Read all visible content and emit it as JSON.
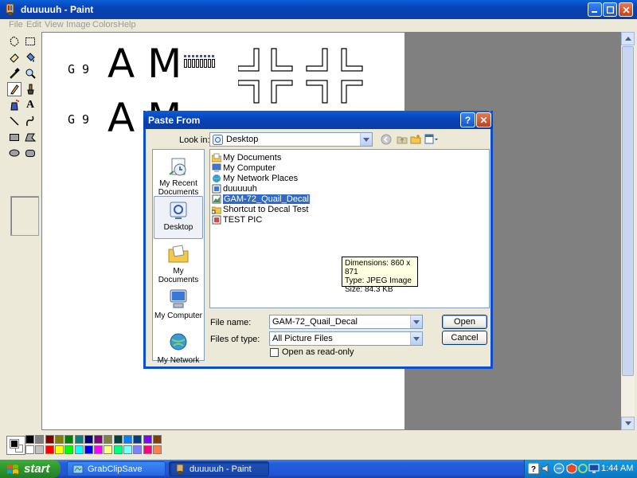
{
  "window": {
    "title": "duuuuuh - Paint"
  },
  "menu": [
    "File",
    "Edit",
    "View",
    "Image",
    "Colors",
    "Help"
  ],
  "canvas_text": {
    "row1_small": "G 9",
    "row1_big": "A M",
    "row2_small": "G 9",
    "row2_big": "A M"
  },
  "dialog": {
    "title": "Paste From",
    "help_glyph": "?",
    "close_glyph": "✕",
    "look_in_label": "Look in:",
    "look_in_value": "Desktop",
    "places": [
      {
        "label": "My Recent Documents",
        "icon": "recent-documents-icon"
      },
      {
        "label": "Desktop",
        "icon": "desktop-icon"
      },
      {
        "label": "My Documents",
        "icon": "my-documents-icon"
      },
      {
        "label": "My Computer",
        "icon": "my-computer-icon"
      },
      {
        "label": "My Network",
        "icon": "my-network-icon"
      }
    ],
    "files": [
      {
        "name": "My Documents",
        "icon": "folder-icon"
      },
      {
        "name": "My Computer",
        "icon": "computer-icon"
      },
      {
        "name": "My Network Places",
        "icon": "network-icon"
      },
      {
        "name": "duuuuuh",
        "icon": "bitmap-icon"
      },
      {
        "name": "GAM-72_Quail_Decal",
        "icon": "jpeg-icon"
      },
      {
        "name": "Shortcut to Decal Test",
        "icon": "shortcut-folder-icon"
      },
      {
        "name": "TEST PIC",
        "icon": "image-icon"
      }
    ],
    "tooltip": {
      "dimensions": "Dimensions: 860 x 871",
      "type": "Type: JPEG Image",
      "size": "Size: 84.3 KB"
    },
    "file_name_label": "File name:",
    "file_name_value": "GAM-72_Quail_Decal",
    "file_type_label": "Files of type:",
    "file_type_value": "All Picture Files",
    "read_only_label": "Open as read-only",
    "open_label": "Open",
    "cancel_label": "Cancel"
  },
  "taskbar": {
    "start_label": "start",
    "tasks": [
      "GrabClipSave",
      "duuuuuh - Paint"
    ],
    "clock": "1:44 AM"
  },
  "palette_colors": [
    "#000000",
    "#808080",
    "#800000",
    "#808000",
    "#008000",
    "#008080",
    "#000080",
    "#800080",
    "#808040",
    "#004040",
    "#0080ff",
    "#004080",
    "#8000ff",
    "#804000",
    "#ffffff",
    "#c0c0c0",
    "#ff0000",
    "#ffff00",
    "#00ff00",
    "#00ffff",
    "#0000ff",
    "#ff00ff",
    "#ffff80",
    "#00ff80",
    "#80ffff",
    "#8080ff",
    "#ff0080",
    "#ff8040"
  ],
  "colors": {
    "title_blue": "#0842b6",
    "selection": "#316ac5",
    "start_green": "#2d962d"
  }
}
